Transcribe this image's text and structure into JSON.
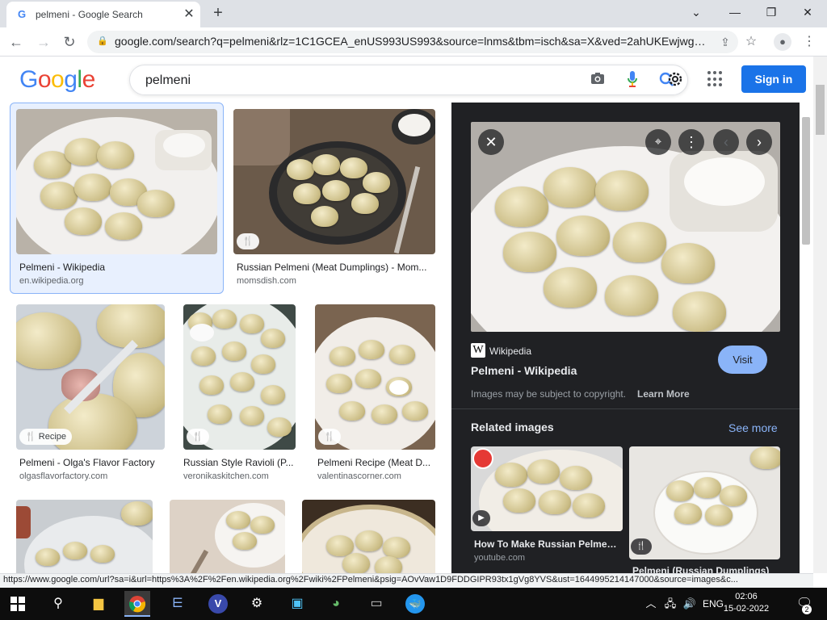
{
  "browser": {
    "tab_title": "pelmeni - Google Search",
    "tab_favicon": "google-g-icon",
    "url": "google.com/search?q=pelmeni&rlz=1C1GCEA_enUS993US993&source=lnms&tbm=isch&sa=X&ved=2ahUKEwjwg4..."
  },
  "search": {
    "logo": [
      "G",
      "o",
      "o",
      "g",
      "l",
      "e"
    ],
    "logo_colors": [
      "#4285f4",
      "#ea4335",
      "#fbbc05",
      "#4285f4",
      "#34a853",
      "#ea4335"
    ],
    "query": "pelmeni",
    "signin_label": "Sign in"
  },
  "results": [
    {
      "title": "Pelmeni - Wikipedia",
      "source": "en.wikipedia.org",
      "badge": ""
    },
    {
      "title": "Russian Pelmeni (Meat Dumplings) - Mom...",
      "source": "momsdish.com",
      "badge": ""
    },
    {
      "title": "Pelmeni - Olga's Flavor Factory",
      "source": "olgasflavorfactory.com",
      "badge": "Recipe"
    },
    {
      "title": "Russian Style Ravioli (P...",
      "source": "veronikaskitchen.com",
      "badge": ""
    },
    {
      "title": "Pelmeni Recipe (Meat D...",
      "source": "valentinascorner.com",
      "badge": ""
    }
  ],
  "panel": {
    "source_name": "Wikipedia",
    "title": "Pelmeni - Wikipedia",
    "visit_label": "Visit",
    "copyright": "Images may be subject to copyright.",
    "learn_more": "Learn More",
    "related_label": "Related images",
    "see_more": "See more",
    "related": [
      {
        "title": "How To Make Russian Pelmeni...",
        "source": "youtube.com"
      },
      {
        "title": "Pelmeni (Russian Dumplings)",
        "source": ""
      }
    ]
  },
  "status_text": "https://www.google.com/url?sa=i&url=https%3A%2F%2Fen.wikipedia.org%2Fwiki%2FPelmeni&psig=AOvVaw1D9FDDGIPR93tx1gVg8YVS&ust=1644995214147000&source=images&c...",
  "taskbar": {
    "lang": "ENG",
    "time": "02:06",
    "date": "15-02-2022",
    "notif_count": "2"
  },
  "colors": {
    "accent": "#1a73e8",
    "panel_bg": "#202124",
    "visit_btn": "#8ab4f8",
    "see_more": "#8ab4f8"
  }
}
